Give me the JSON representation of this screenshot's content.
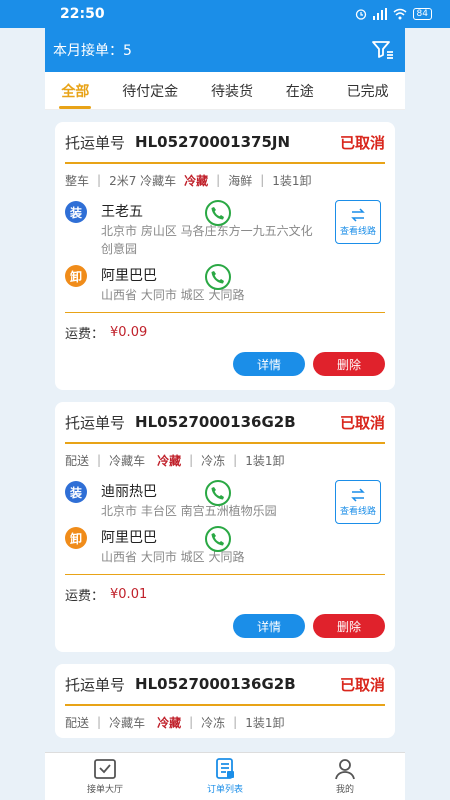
{
  "status_bar": {
    "time": "22:50",
    "battery": "84"
  },
  "header": {
    "monthly_orders": "本月接单：5"
  },
  "tabs": [
    {
      "label": "全部"
    },
    {
      "label": "待付定金"
    },
    {
      "label": "待装货"
    },
    {
      "label": "在途"
    },
    {
      "label": "已完成"
    }
  ],
  "orders": [
    {
      "waybill_label": "托运单号",
      "waybill_no": "HL05270001375JN",
      "status": "已取消",
      "tags": [
        "整车",
        "2米7 冷藏车",
        "冷藏",
        "海鲜",
        "1装1卸"
      ],
      "load": {
        "badge": "装",
        "name": "王老五",
        "address": "北京市 房山区 马各庄东方一九五六文化创意园"
      },
      "unload": {
        "badge": "卸",
        "name": "阿里巴巴",
        "address": "山西省 大同市 城区 大同路"
      },
      "route_button": "查看线路",
      "fee_label": "运费：",
      "fee": "¥0.09",
      "detail_button": "详情",
      "delete_button": "删除"
    },
    {
      "waybill_label": "托运单号",
      "waybill_no": "HL0527000136G2B",
      "status": "已取消",
      "tags": [
        "配送",
        "冷藏车",
        "冷藏",
        "冷冻",
        "1装1卸"
      ],
      "load": {
        "badge": "装",
        "name": "迪丽热巴",
        "address": "北京市 丰台区 南宫五洲植物乐园"
      },
      "unload": {
        "badge": "卸",
        "name": "阿里巴巴",
        "address": "山西省 大同市 城区 大同路"
      },
      "route_button": "查看线路",
      "fee_label": "运费：",
      "fee": "¥0.01",
      "detail_button": "详情",
      "delete_button": "删除"
    },
    {
      "waybill_label": "托运单号",
      "waybill_no": "HL0527000136G2B",
      "status": "已取消",
      "tags": [
        "配送",
        "冷藏车",
        "冷藏",
        "冷冻",
        "1装1卸"
      ]
    }
  ],
  "bottom_nav": [
    {
      "label": "接单大厅",
      "icon": "order-hall-icon"
    },
    {
      "label": "订单列表",
      "icon": "order-list-icon"
    },
    {
      "label": "我的",
      "icon": "profile-icon"
    }
  ]
}
